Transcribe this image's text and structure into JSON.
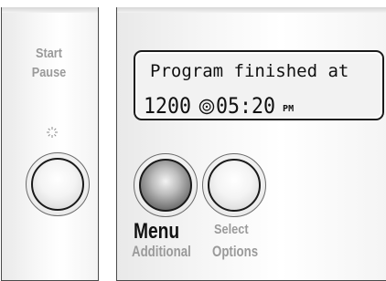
{
  "left_panel": {
    "start_label": "Start",
    "pause_label": "Pause",
    "led_icon": "sparkle-led-icon"
  },
  "display": {
    "line1": "Program finished at",
    "time_part1": "1200",
    "clock_icon": "clock-icon",
    "time_part2": "05:20",
    "ampm": "PM"
  },
  "controls": {
    "menu_label": "Menu",
    "additional_label": "Additional",
    "select_label": "Select",
    "options_label": "Options"
  },
  "colors": {
    "panel_border": "#4a4a4a",
    "label_grey": "#9a9a9a",
    "display_bg": "#f2f2f2",
    "text_dark": "#111111"
  }
}
